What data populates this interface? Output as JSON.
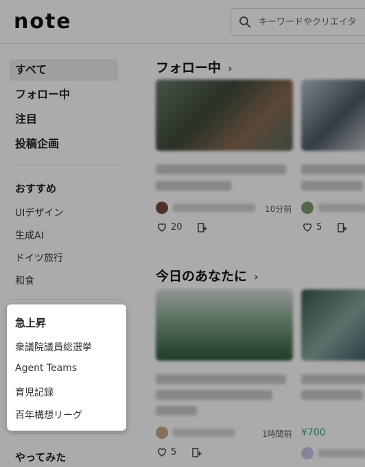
{
  "header": {
    "logo": "note",
    "search_placeholder": "キーワードやクリエイタ"
  },
  "sidebar": {
    "main_items": [
      "すべて",
      "フォロー中",
      "注目",
      "投稿企画"
    ],
    "recommend_title": "おすすめ",
    "recommend_items": [
      "UIデザイン",
      "生成AI",
      "ドイツ旅行",
      "和食"
    ],
    "trending_title": "急上昇",
    "trending_items": [
      "衆議院議員総選挙",
      "Agent Teams",
      "育児記録",
      "百年構想リーグ"
    ],
    "bottom_title": "やってみた"
  },
  "main": {
    "following": {
      "title": "フォロー中",
      "card1": {
        "time": "10分前",
        "likes": "20"
      },
      "card2": {
        "likes": "5"
      }
    },
    "today": {
      "title": "今日のあなたに",
      "card1": {
        "time": "1時間前",
        "price": "¥700",
        "likes": "5"
      }
    }
  },
  "colors": {
    "price": "#3d9c83",
    "overlay": "rgba(0,0,0,0.33)"
  }
}
